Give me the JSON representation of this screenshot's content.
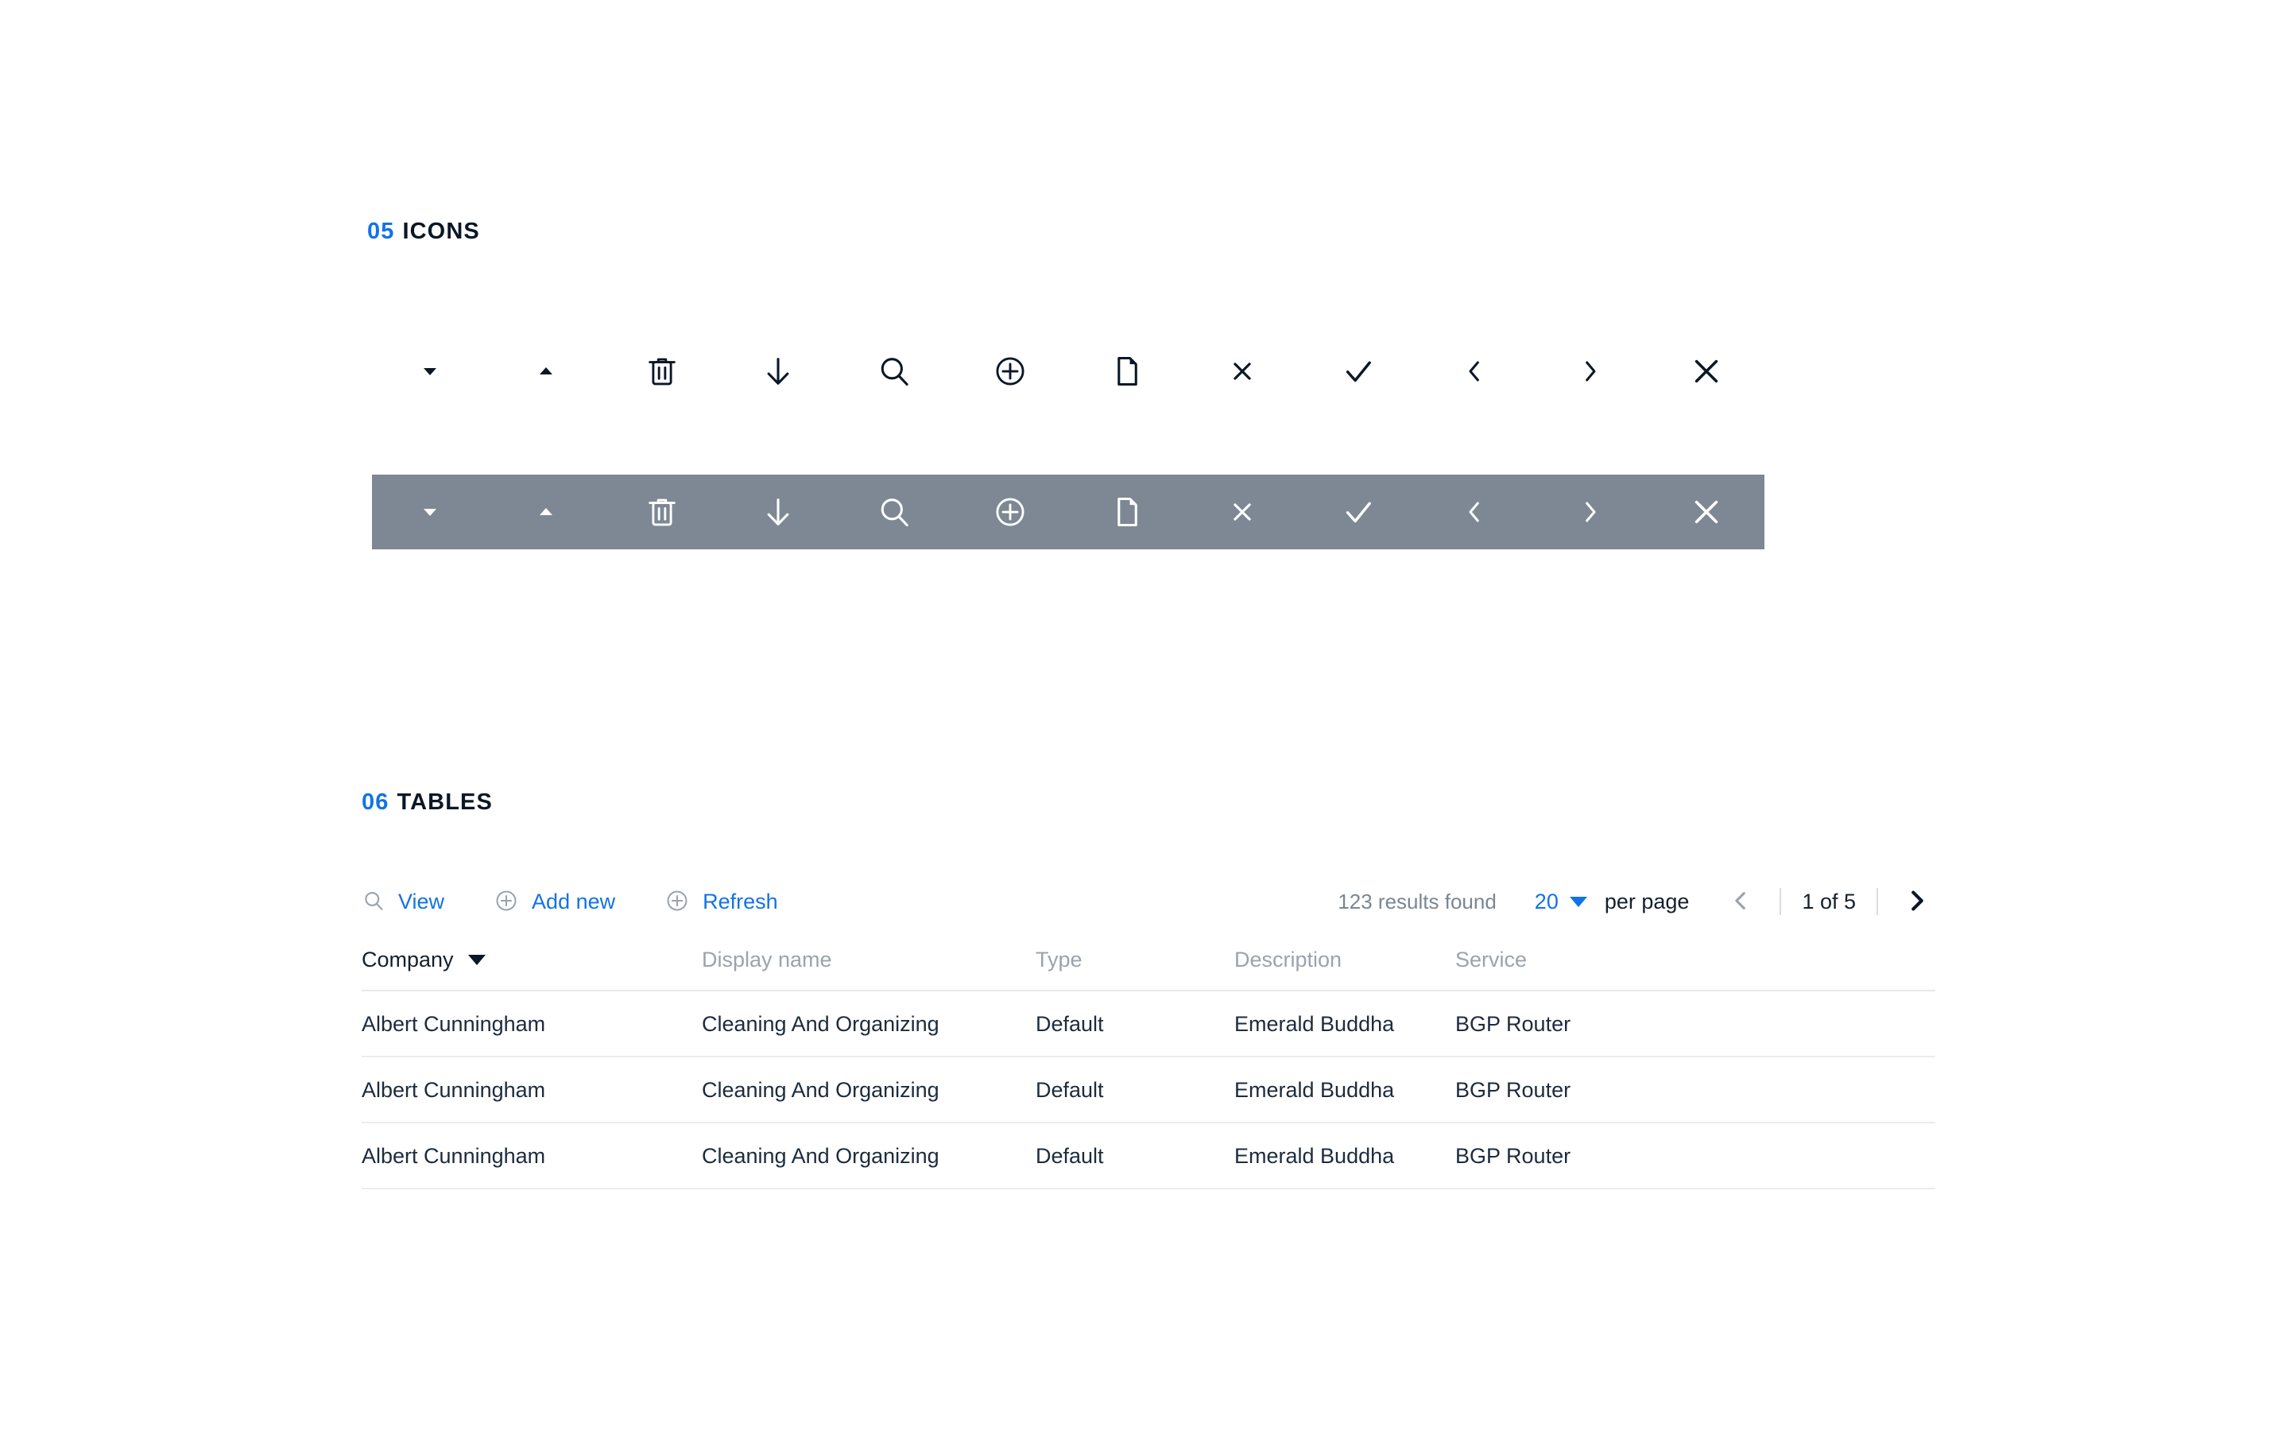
{
  "sections": {
    "icons": {
      "number": "05",
      "title": "ICONS"
    },
    "tables": {
      "number": "06",
      "title": "TABLES"
    }
  },
  "icon_set": [
    {
      "name": "caret-down-icon",
      "label": "caret down"
    },
    {
      "name": "caret-up-icon",
      "label": "caret up"
    },
    {
      "name": "trash-icon",
      "label": "delete"
    },
    {
      "name": "arrow-down-icon",
      "label": "download"
    },
    {
      "name": "search-icon",
      "label": "search"
    },
    {
      "name": "plus-circle-icon",
      "label": "add"
    },
    {
      "name": "file-icon",
      "label": "document"
    },
    {
      "name": "close-x-icon",
      "label": "close"
    },
    {
      "name": "check-icon",
      "label": "confirm"
    },
    {
      "name": "chevron-left-icon",
      "label": "previous"
    },
    {
      "name": "chevron-right-icon",
      "label": "next"
    },
    {
      "name": "close-large-x-icon",
      "label": "dismiss"
    }
  ],
  "icon_rows": [
    {
      "variant": "light",
      "background": "#ffffff",
      "icon_color": "#0b1727"
    },
    {
      "variant": "dark",
      "background": "#7d8894",
      "icon_color": "#ffffff"
    }
  ],
  "table": {
    "toolbar": {
      "view_label": "View",
      "add_new_label": "Add new",
      "refresh_label": "Refresh"
    },
    "pagination": {
      "results_found": "123 results found",
      "per_page_value": "20",
      "per_page_label": "per page",
      "page_status": "1 of 5",
      "prev_enabled": false,
      "next_enabled": true
    },
    "columns": [
      {
        "label": "Company",
        "sorted": true,
        "sort_direction": "desc"
      },
      {
        "label": "Display name",
        "sorted": false,
        "sort_direction": null
      },
      {
        "label": "Type",
        "sorted": false,
        "sort_direction": null
      },
      {
        "label": "Description",
        "sorted": false,
        "sort_direction": null
      },
      {
        "label": "Service",
        "sorted": false,
        "sort_direction": null
      }
    ],
    "rows": [
      [
        "Albert Cunningham",
        "Cleaning And Organizing",
        "Default",
        "Emerald Buddha",
        "BGP Router"
      ],
      [
        "Albert Cunningham",
        "Cleaning And Organizing",
        "Default",
        "Emerald Buddha",
        "BGP Router"
      ],
      [
        "Albert Cunningham",
        "Cleaning And Organizing",
        "Default",
        "Emerald Buddha",
        "BGP Router"
      ]
    ]
  },
  "colors": {
    "accent_blue": "#1273e6",
    "heading_dark": "#0b1727",
    "muted_gray": "#9aa3ad",
    "dark_bar": "#7d8894",
    "body_text": "#1d2b3e",
    "divider": "#eaecee"
  }
}
